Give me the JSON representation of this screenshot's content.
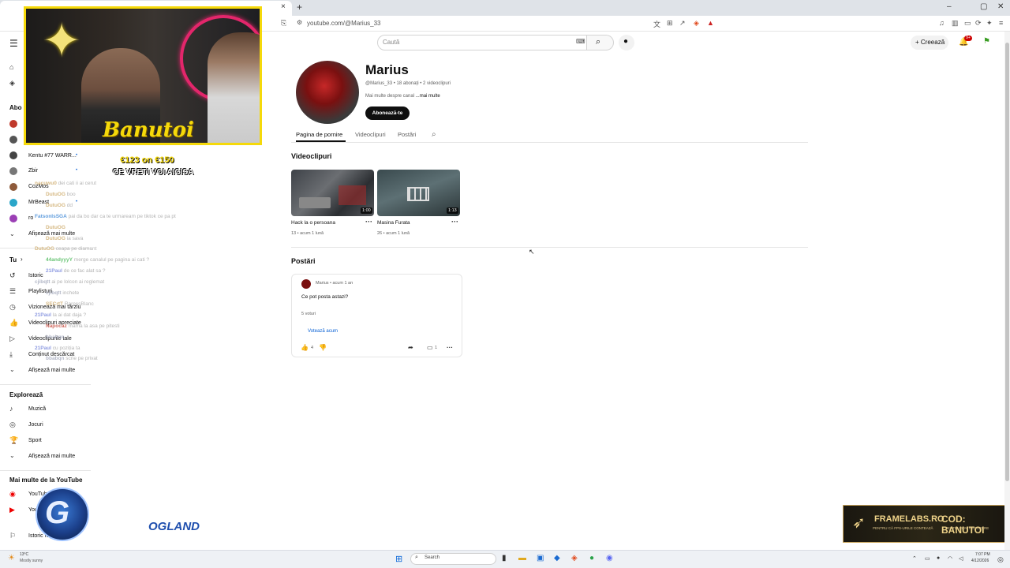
{
  "browser": {
    "url": "youtube.com/@Marius_33",
    "tab_close": "×",
    "new_tab": "+"
  },
  "header": {
    "search_placeholder": "Caută",
    "create_label": "Creează",
    "notif_badge": "9+"
  },
  "sidebar": {
    "subs_heading": "Abo",
    "subs": [
      {
        "label": "Kentu #77 WARR...",
        "dot": "•"
      },
      {
        "label": "Zbir",
        "dot": "•"
      },
      {
        "label": "CozMos",
        "dot": ""
      },
      {
        "label": "MrBeast",
        "dot": "•"
      },
      {
        "label": "ro",
        "dot": ""
      }
    ],
    "subs_more": "Afișează mai multe",
    "you_heading": "Tu",
    "you_items": [
      {
        "label": "Istoric"
      },
      {
        "label": "Playlisturi"
      },
      {
        "label": "Vizionează mai târziu"
      },
      {
        "label": "Videoclipuri apreciate"
      },
      {
        "label": "Videoclipurile tale"
      },
      {
        "label": "Conținut descărcat"
      }
    ],
    "you_more": "Afișează mai multe",
    "explore_heading": "Explorează",
    "explore_items": [
      {
        "label": "Muzică"
      },
      {
        "label": "Jocuri"
      },
      {
        "label": "Sport"
      }
    ],
    "explore_more": "Afișează mai multe",
    "more_heading": "Mai multe de la YouTube",
    "more_items": [
      {
        "label": "YouTube Premium"
      },
      {
        "label": "YouTube Music"
      }
    ],
    "report_label": "Istoric raportări"
  },
  "channel": {
    "name": "Marius",
    "meta": "@Marius_33 • 18 abonați • 2 videoclipuri",
    "desc_prefix": "Mai multe despre canal ",
    "desc_more": "...mai multe",
    "subscribe": "Abonează-te",
    "tabs": [
      "Pagina de pornire",
      "Videoclipuri",
      "Postări"
    ]
  },
  "videos_section": {
    "title": "Videoclipuri",
    "items": [
      {
        "title": "Hack la o persoana",
        "meta": "13 • acum 1 lună",
        "duration": "1:00"
      },
      {
        "title": "Masina Furata",
        "meta": "26 • acum 1 lună",
        "duration": "1:13"
      }
    ]
  },
  "posts_section": {
    "title": "Postări",
    "post": {
      "author": "Marius • acum 1 an",
      "text": "Ce pot posta astazi?",
      "votes": "5 voturi",
      "vote_btn": "Votează acum",
      "likes": "4",
      "comments": "1"
    }
  },
  "overlay": {
    "streamer": "Banutoi",
    "goal": "€123 on €150",
    "goal_sub": "CE VRETI VOI AICISA",
    "chat": [
      {
        "user": "nacuwu0",
        "msg": "dei cati ii ai cerut",
        "color": "#c8a15a"
      },
      {
        "user": "DutuOG",
        "msg": "boo",
        "color": "#c8a15a"
      },
      {
        "user": "DutuOG",
        "msg": "dd",
        "color": "#c8a15a"
      },
      {
        "user": "FatsonIsSGA",
        "msg": "pai da bo dar ca te urmaream pe tiktok ce pa pt",
        "color": "#2d7dd2"
      },
      {
        "user": "DutuOG",
        "msg": "",
        "color": "#c8a15a"
      },
      {
        "user": "DutuOG",
        "msg": "ia sava",
        "color": "#c8a15a"
      },
      {
        "user": "DutuOG",
        "msg": "ceapa pe diamant",
        "color": "#c8a15a"
      },
      {
        "user": "44andyyyY",
        "msg": "merge canalul pe pagina ai cati ?",
        "color": "#3ab24a"
      },
      {
        "user": "21Paul",
        "msg": "de ce fac alat sa ?",
        "color": "#6a7bd8"
      },
      {
        "user": "cjibqtt",
        "msg": "ai pe lolcon ai reglemat",
        "color": "#9aa0b5"
      },
      {
        "user": "cjibqtt",
        "msg": "inchete",
        "color": "#9aa0b5"
      },
      {
        "user": "SECrtT",
        "msg": "RaressBlanc",
        "color": "#c8a15a"
      },
      {
        "user": "21Paul",
        "msg": "la ai dat daja ?",
        "color": "#6a7bd8"
      },
      {
        "user": "Napocaz",
        "msg": "mama la asa pe pitesti",
        "color": "#c0392b"
      },
      {
        "user": "bbabqn",
        "msg": "",
        "color": "#9aa0b5"
      },
      {
        "user": "21Paul",
        "msg": "cu poziția ta",
        "color": "#6a7bd8"
      },
      {
        "user": "bbabqn",
        "msg": "scrie pe privat",
        "color": "#9aa0b5"
      }
    ],
    "ogland": "OGLAND",
    "logo_letter": "G"
  },
  "promo": {
    "brand": "FRAMELABS.RO",
    "brand_sub": "PENTRU CĂ FPS-URILE CONTEAZĂ",
    "code": "COD: BANUTOI",
    "code_sub": "PENTRU 10% REDUCERE"
  },
  "taskbar": {
    "temp": "13°C",
    "weather": "Mostly sunny",
    "search": "Search",
    "time": "7:07 PM",
    "date": "4/12/2026"
  }
}
